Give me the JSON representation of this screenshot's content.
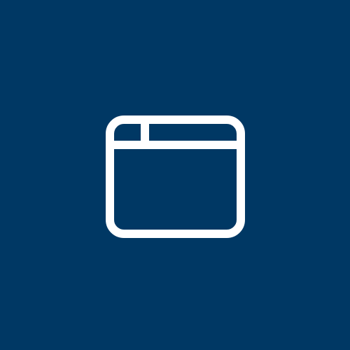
{
  "colors": {
    "background": "#003864",
    "icon": "#ffffff"
  },
  "icon": {
    "name": "browser-window-icon"
  }
}
